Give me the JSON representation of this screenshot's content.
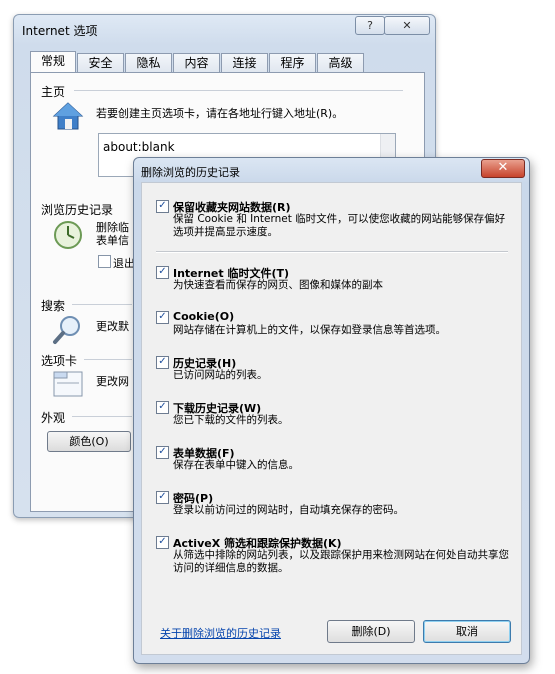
{
  "internet_options": {
    "title": "Internet 选项",
    "help_label": "?",
    "close_label": "✕",
    "tabs": [
      "常规",
      "安全",
      "隐私",
      "内容",
      "连接",
      "程序",
      "高级"
    ],
    "home": {
      "section": "主页",
      "description": "若要创建主页选项卡，请在各地址行键入地址(R)。",
      "url": "about:blank"
    },
    "history": {
      "section": "浏览历史记录",
      "desc_line1": "删除临",
      "desc_line2": "表单信",
      "checkbox_label": "退出"
    },
    "search": {
      "section": "搜索",
      "desc": "更改默"
    },
    "tabs_section": {
      "section": "选项卡",
      "desc": "更改网"
    },
    "appearance": {
      "section": "外观",
      "colors_button": "颜色(O)"
    }
  },
  "delete_history": {
    "title": "删除浏览的历史记录",
    "close_label": "✕",
    "options": [
      {
        "label": "保留收藏夹网站数据(R)",
        "checked": true,
        "desc": "保留 Cookie 和 Internet 临时文件，可以使您收藏的网站能够保存偏好选项并提高显示速度。"
      },
      {
        "label": "Internet 临时文件(T)",
        "checked": true,
        "desc": "为快速查看而保存的网页、图像和媒体的副本"
      },
      {
        "label": "Cookie(O)",
        "checked": true,
        "desc": "网站存储在计算机上的文件，以保存如登录信息等首选项。"
      },
      {
        "label": "历史记录(H)",
        "checked": true,
        "desc": "已访问网站的列表。"
      },
      {
        "label": "下载历史记录(W)",
        "checked": true,
        "desc": "您已下载的文件的列表。"
      },
      {
        "label": "表单数据(F)",
        "checked": true,
        "desc": "保存在表单中键入的信息。"
      },
      {
        "label": "密码(P)",
        "checked": true,
        "desc": "登录以前访问过的网站时，自动填充保存的密码。"
      },
      {
        "label": "ActiveX 筛选和跟踪保护数据(K)",
        "checked": true,
        "desc": "从筛选中排除的网站列表，以及跟踪保护用来检测网站在何处自动共享您访问的详细信息的数据。"
      }
    ],
    "check_mark": "✓",
    "about_link": "关于删除浏览的历史记录",
    "delete_button": "删除(D)",
    "cancel_button": "取消"
  }
}
